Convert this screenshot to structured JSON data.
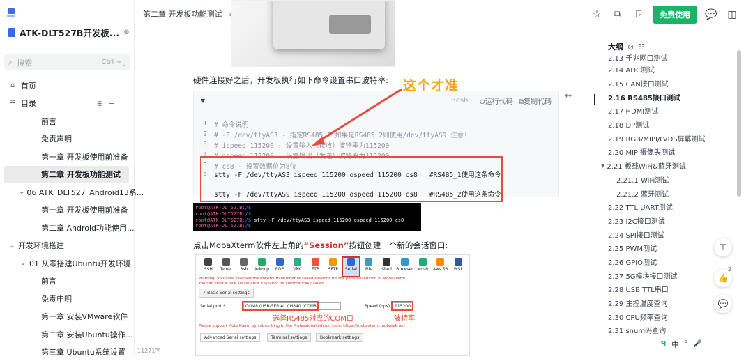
{
  "sidebar": {
    "title": "ATK-DLT527B开发板...",
    "search_placeholder": "搜索",
    "search_shortcut": "Ctrl + J",
    "home": "首页",
    "toc": "目录",
    "items": [
      {
        "label": "前言"
      },
      {
        "label": "免责声明"
      },
      {
        "label": "第一章 开发板使用前准备"
      },
      {
        "label": "第二章 开发板功能测试"
      },
      {
        "label": "06 ATK_DLT527_Android13系..."
      },
      {
        "label": "第一章 开发板使用前准备"
      },
      {
        "label": "第二章 Android功能使用..."
      },
      {
        "label": "开发环境搭建"
      },
      {
        "label": "01 从零搭建Ubuntu开发环境"
      },
      {
        "label": "前言"
      },
      {
        "label": "免责申明"
      },
      {
        "label": "第一章 安装VMware软件"
      },
      {
        "label": "第二章 安装Ubuntu操作..."
      },
      {
        "label": "第三章 Ubuntu系统设置"
      }
    ],
    "word_count": "11271字"
  },
  "topbar": {
    "breadcrumb": "第二章 开发板功能测试",
    "free_button": "免费使用"
  },
  "content": {
    "para1": "硬件连接好之后，开发板执行如下命令设置串口波特率:",
    "annotation": "这个才准",
    "code": {
      "language": "Bash",
      "run_label": "运行代码",
      "copy_label": "复制代码",
      "lines": [
        {
          "n": "1",
          "text": "# 命令说明"
        },
        {
          "n": "2",
          "text": "# -F /dev/ttyAS3 - 指定RS485_1 如果是RS485_2则使用/dev/ttyAS9 注意!"
        },
        {
          "n": "3",
          "text": "# ispeed 115200 - 设置输入（接收）波特率为115200"
        },
        {
          "n": "4",
          "text": "# ospeed 115200 - 设置输出（发送）波特率为115200"
        },
        {
          "n": "5",
          "text": "# cs8 - 设置数据位为8位"
        },
        {
          "n": "6",
          "text": "stty -F /dev/ttyAS3 ispeed 115200 ospeed 115200 cs8   #RS485_1使用这条命令"
        },
        {
          "n": "",
          "text": "stty -F /dev/ttyAS9 ispeed 115200 ospeed 115200 cs8   #RS485_2使用这条命令"
        }
      ]
    },
    "terminal": [
      {
        "prompt": "root@ATK-DLT527B",
        "path": ":/$",
        "cmd": ""
      },
      {
        "prompt": "root@ATK-DLT527B",
        "path": ":/$",
        "cmd": ""
      },
      {
        "prompt": "root@ATK-DLT527B",
        "path": ":/$",
        "cmd": " stty -F /dev/ttyAS3 ispeed 115200 ospeed 115200 cs8"
      },
      {
        "prompt": "root@ATK-DLT527B",
        "path": ":/$",
        "cmd": ""
      },
      {
        "prompt": "root@ATK-DLT527B",
        "path": ":/$",
        "cmd": ""
      }
    ],
    "para2_pre": "点击MobaXterm软件左上角的",
    "para2_hl": "“Session”",
    "para2_post": "按钮创建一个新的会话窗口:",
    "moba": {
      "toolbar": [
        "SSH",
        "Telnet",
        "Rsh",
        "Xdmcp",
        "RDP",
        "VNC",
        "FTP",
        "SFTP",
        "Serial",
        "File",
        "Shell",
        "Browser",
        "Mosh",
        "Aws S3",
        "WSL"
      ],
      "warning1": "Warning: you have reached the maximum number of saved sessions for the personal edition of MobaXterm.",
      "warning2": "You can start a new session but it will not be automatically saved.",
      "basic_tab": "Basic Serial settings",
      "port_label": "Serial port *",
      "port_value": "COM8  (USB-SERIAL CH340 (COM8))",
      "speed_label": "Speed (bps) *",
      "speed_value": "115200",
      "note_port": "选择RS485对应的COM口",
      "note_speed": "波特率",
      "support": "Please support MobaXterm by subscribing to the Professional edition here: https://mobaxterm.mobatek.net",
      "adv_tabs": [
        "Advanced Serial settings",
        "Terminal settings",
        "Bookmark settings"
      ]
    }
  },
  "toc": {
    "title": "大纲",
    "items": [
      {
        "label": "2.13 千兆网口测试"
      },
      {
        "label": "2.14 ADC测试"
      },
      {
        "label": "2.15 CAN接口测试"
      },
      {
        "label": "2.16 RS485接口测试"
      },
      {
        "label": "2.17 HDMI测试"
      },
      {
        "label": "2.18 DP测试"
      },
      {
        "label": "2.19 RGB/MIPI/LVDS屏幕测试"
      },
      {
        "label": "2.20 MIPI摄像头测试"
      },
      {
        "label": "2.21 板载WiFi&蓝牙测试"
      },
      {
        "label": "2.21.1 WiFi测试"
      },
      {
        "label": "2.21.2 蓝牙测试"
      },
      {
        "label": "2.22 TTL UART测试"
      },
      {
        "label": "2.23 I2C接口测试"
      },
      {
        "label": "2.24 SPI接口测试"
      },
      {
        "label": "2.25 PWM测试"
      },
      {
        "label": "2.26 GPIO测试"
      },
      {
        "label": "2.27 5G模块接口测试"
      },
      {
        "label": "2.28 USB TTL串口"
      },
      {
        "label": "2.29 主控温度查询"
      },
      {
        "label": "2.30 CPU频率查询"
      },
      {
        "label": "2.31 snum码查询"
      }
    ]
  },
  "floating": {
    "like_count": "2"
  },
  "ime": {
    "lang": "中"
  }
}
